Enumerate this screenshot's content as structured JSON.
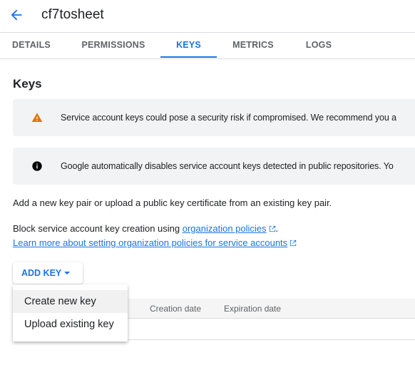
{
  "header": {
    "title": "cf7tosheet",
    "back_icon": "arrow-back-icon"
  },
  "tabs": [
    {
      "label": "DETAILS"
    },
    {
      "label": "PERMISSIONS"
    },
    {
      "label": "KEYS",
      "active": true
    },
    {
      "label": "METRICS"
    },
    {
      "label": "LOGS"
    }
  ],
  "section": {
    "title": "Keys"
  },
  "banners": [
    {
      "icon": "warning-icon",
      "color": "#e37400",
      "text": "Service account keys could pose a security risk if compromised. We recommend you a"
    },
    {
      "icon": "info-icon",
      "color": "#000000",
      "text": "Google automatically disables service account keys detected in public repositories. Yo"
    }
  ],
  "description": "Add a new key pair or upload a public key certificate from an existing key pair.",
  "policy": {
    "prefix": "Block service account key creation using ",
    "link": "organization policies",
    "suffix": ".",
    "learn_more": "Learn more about setting organization policies for service accounts"
  },
  "add_key": {
    "label": "ADD KEY",
    "menu": [
      "Create new key",
      "Upload existing key"
    ]
  },
  "table": {
    "columns": [
      "Creation date",
      "Expiration date"
    ]
  },
  "colors": {
    "accent": "#1a73e8"
  }
}
